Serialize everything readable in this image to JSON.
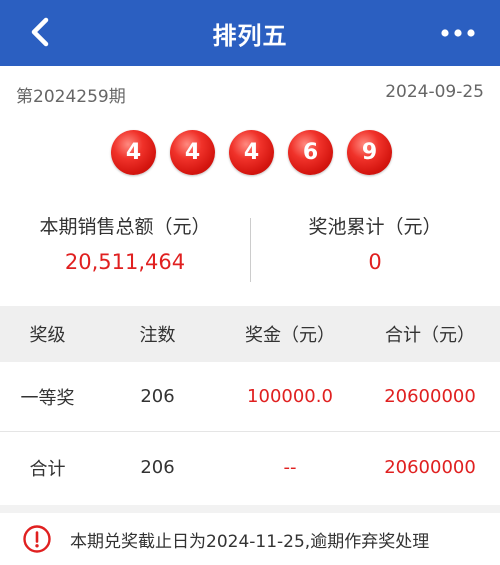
{
  "header": {
    "title": "排列五",
    "back_icon": "chevron-left-icon",
    "more_icon": "more-horizontal-icon"
  },
  "draw": {
    "period": "第2024259期",
    "date": "2024-09-25",
    "numbers": [
      "4",
      "4",
      "4",
      "6",
      "9"
    ]
  },
  "stats": {
    "sales_label": "本期销售总额（元）",
    "sales_value": "20,511,464",
    "pool_label": "奖池累计（元）",
    "pool_value": "0"
  },
  "table": {
    "headers": [
      "奖级",
      "注数",
      "奖金（元）",
      "合计（元）"
    ],
    "rows": [
      [
        "一等奖",
        "206",
        "100000.0",
        "20600000"
      ],
      [
        "合计",
        "206",
        "--",
        "20600000"
      ]
    ]
  },
  "notice": {
    "text": "本期兑奖截止日为2024-11-25,逾期作弃奖处理",
    "icon": "alert-circle-icon"
  },
  "colors": {
    "header_bg": "#2b5fc1",
    "accent_red": "#e02020",
    "ball_red": "#e0201a"
  }
}
